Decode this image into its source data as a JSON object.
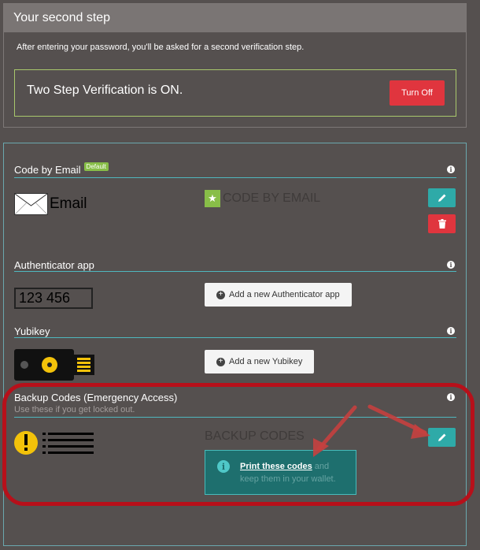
{
  "step": {
    "title": "Your second step",
    "description": "After entering your password, you'll be asked for a second verification step.",
    "status_text": "Two Step Verification is ON.",
    "turn_off_label": "Turn Off"
  },
  "methods": {
    "email": {
      "title": "Code by Email",
      "badge": "Default",
      "icon_label": "Email",
      "method_name": "CODE BY EMAIL"
    },
    "authenticator": {
      "title": "Authenticator app",
      "code_sample": "123 456",
      "add_label": "Add a new Authenticator app"
    },
    "yubikey": {
      "title": "Yubikey",
      "add_label": "Add a new Yubikey"
    },
    "backup": {
      "title": "Backup Codes (Emergency Access)",
      "subtitle": "Use these if you get locked out.",
      "method_name": "BACKUP CODES",
      "print_link": "Print these codes",
      "print_text_rest": " and keep them in your wallet."
    }
  },
  "colors": {
    "background": "#55504f",
    "accent_teal": "#2eaaa8",
    "danger": "#e0353e",
    "success_green": "#88be48",
    "annotation_red": "#b7101a"
  },
  "icons": [
    "info-icon",
    "star-icon",
    "pencil-icon",
    "trash-icon",
    "plus-circle-icon",
    "envelope-icon",
    "yubikey-icon",
    "warning-icon",
    "list-icon"
  ]
}
